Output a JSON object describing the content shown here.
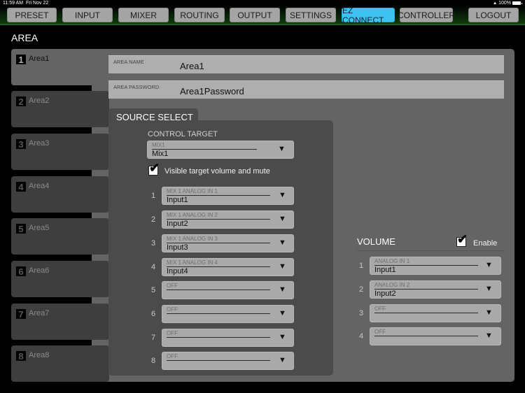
{
  "status": {
    "time": "11:59 AM",
    "date": "Fri Nov 22",
    "battery": "100%"
  },
  "nav": [
    {
      "label": "PRESET"
    },
    {
      "label": "INPUT"
    },
    {
      "label": "MIXER"
    },
    {
      "label": "ROUTING"
    },
    {
      "label": "OUTPUT"
    },
    {
      "label": "SETTINGS"
    },
    {
      "label": "EZ CONNECT",
      "active": true
    },
    {
      "label": "CONTROLLER"
    },
    {
      "label": "LOGOUT"
    }
  ],
  "colors": {
    "accent": "#3cc4f0",
    "panel": "#646464",
    "field": "#aeaeae"
  },
  "area_title": "AREA",
  "areas": [
    {
      "num": "1",
      "name": "Area1",
      "selected": true
    },
    {
      "num": "2",
      "name": "Area2"
    },
    {
      "num": "3",
      "name": "Area3"
    },
    {
      "num": "4",
      "name": "Area4"
    },
    {
      "num": "5",
      "name": "Area5"
    },
    {
      "num": "6",
      "name": "Area6"
    },
    {
      "num": "7",
      "name": "Area7"
    },
    {
      "num": "8",
      "name": "Area8"
    }
  ],
  "area_name": {
    "label": "AREA NAME",
    "value": "Area1"
  },
  "area_password": {
    "label": "AREA PASSWORD",
    "value": "Area1Password"
  },
  "source_select": {
    "title": "SOURCE SELECT",
    "control_target_label": "CONTROL TARGET",
    "control_target": {
      "hint": "MIX1",
      "value": "Mix1"
    },
    "visible_checkbox": {
      "label": "Visible target volume and mute",
      "checked": true
    },
    "sources": [
      {
        "num": "1",
        "hint": "MIX 1 ANALOG IN 1",
        "value": "Input1"
      },
      {
        "num": "2",
        "hint": "MIX 1 ANALOG IN 2",
        "value": "Input2"
      },
      {
        "num": "3",
        "hint": "MIX 1 ANALOG IN 3",
        "value": "Input3"
      },
      {
        "num": "4",
        "hint": "MIX 1 ANALOG IN 4",
        "value": "Input4"
      },
      {
        "num": "5",
        "hint": "OFF",
        "value": ""
      },
      {
        "num": "6",
        "hint": "OFF",
        "value": ""
      },
      {
        "num": "7",
        "hint": "OFF",
        "value": ""
      },
      {
        "num": "8",
        "hint": "OFF",
        "value": ""
      }
    ]
  },
  "volume": {
    "title": "VOLUME",
    "enable": {
      "label": "Enable",
      "checked": true
    },
    "items": [
      {
        "num": "1",
        "hint": "ANALOG IN 1",
        "value": "Input1"
      },
      {
        "num": "2",
        "hint": "ANALOG IN 2",
        "value": "Input2"
      },
      {
        "num": "3",
        "hint": "OFF",
        "value": ""
      },
      {
        "num": "4",
        "hint": "OFF",
        "value": ""
      }
    ]
  },
  "icons": {
    "dropdown": "▼",
    "check": "✔",
    "wifi": "wifi-icon",
    "battery": "battery-icon"
  }
}
